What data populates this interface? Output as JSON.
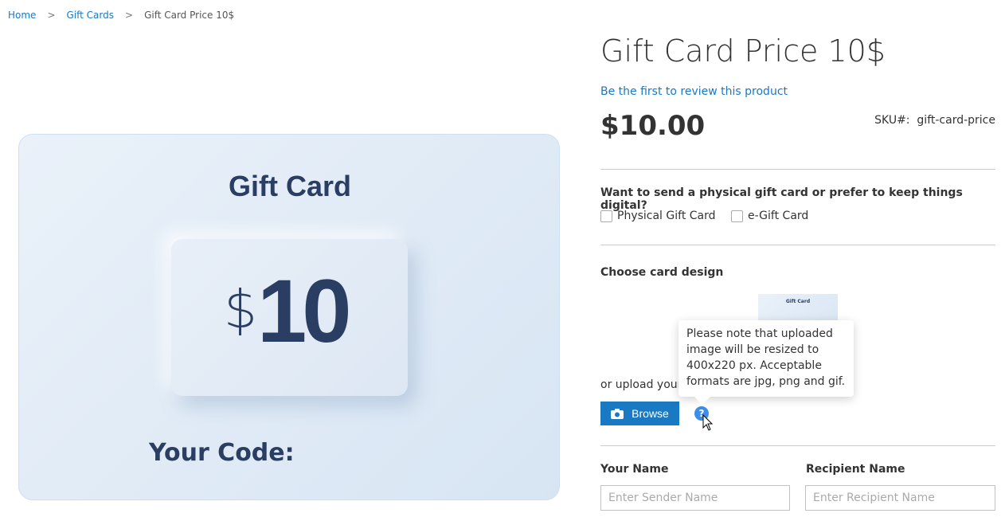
{
  "breadcrumbs": [
    {
      "label": "Home"
    },
    {
      "label": "Gift Cards"
    },
    {
      "label": "Gift Card Price 10$"
    }
  ],
  "card_image": {
    "title": "Gift Card",
    "currency": "$",
    "amount": "10",
    "code_label": "Your Code:"
  },
  "product": {
    "title": "Gift Card Price 10$",
    "review_link": "Be the first to review this product",
    "price": "$10.00",
    "sku_label": "SKU#:",
    "sku": "gift-card-price"
  },
  "type": {
    "question": "Want to send a physical gift card or prefer to keep things digital?",
    "options": [
      {
        "label": "Physical Gift Card",
        "checked": false
      },
      {
        "label": "e-Gift Card",
        "checked": false
      }
    ]
  },
  "design": {
    "label": "Choose card design",
    "thumb_title": "Gift Card",
    "upload_text": "or upload your",
    "browse": "Browse",
    "help": "?",
    "tooltip": "Please note that uploaded image will be resized to 400x220 px. Acceptable formats are jpg, png and gif."
  },
  "form": {
    "sender_label": "Your Name",
    "sender_placeholder": "Enter Sender Name",
    "recipient_label": "Recipient Name",
    "recipient_placeholder": "Enter Recipient Name"
  },
  "colors": {
    "accent": "#1979c3",
    "card_text": "#2a3d63"
  }
}
